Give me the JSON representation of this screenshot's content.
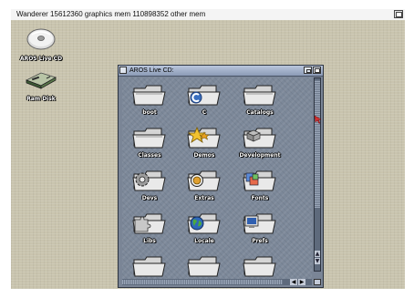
{
  "screen": {
    "title": "Wanderer  15612360 graphics mem  110898352 other mem"
  },
  "desktop": {
    "icons": [
      {
        "label": "AROS Live CD",
        "icon": "cd-disk-icon"
      },
      {
        "label": "Ram Disk",
        "icon": "ram-disk-icon"
      }
    ]
  },
  "window": {
    "title": "AROS Live CD:",
    "items": [
      {
        "label": "boot",
        "icon": "drawer-icon"
      },
      {
        "label": "C",
        "icon": "c-drawer-icon"
      },
      {
        "label": "Catalogs",
        "icon": "drawer-icon"
      },
      {
        "label": "Classes",
        "icon": "drawer-icon"
      },
      {
        "label": "Demos",
        "icon": "star-drawer-icon"
      },
      {
        "label": "Development",
        "icon": "dev-drawer-icon"
      },
      {
        "label": "Devs",
        "icon": "gear-drawer-icon"
      },
      {
        "label": "Extras",
        "icon": "extras-drawer-icon"
      },
      {
        "label": "Fonts",
        "icon": "fonts-drawer-icon"
      },
      {
        "label": "Libs",
        "icon": "puzzle-drawer-icon"
      },
      {
        "label": "Locale",
        "icon": "globe-drawer-icon"
      },
      {
        "label": "Prefs",
        "icon": "prefs-drawer-icon"
      }
    ]
  },
  "colors": {
    "desktop": "#c9c4ae",
    "window_bg": "#7c8899",
    "titlebar": "#b9c6dc"
  }
}
